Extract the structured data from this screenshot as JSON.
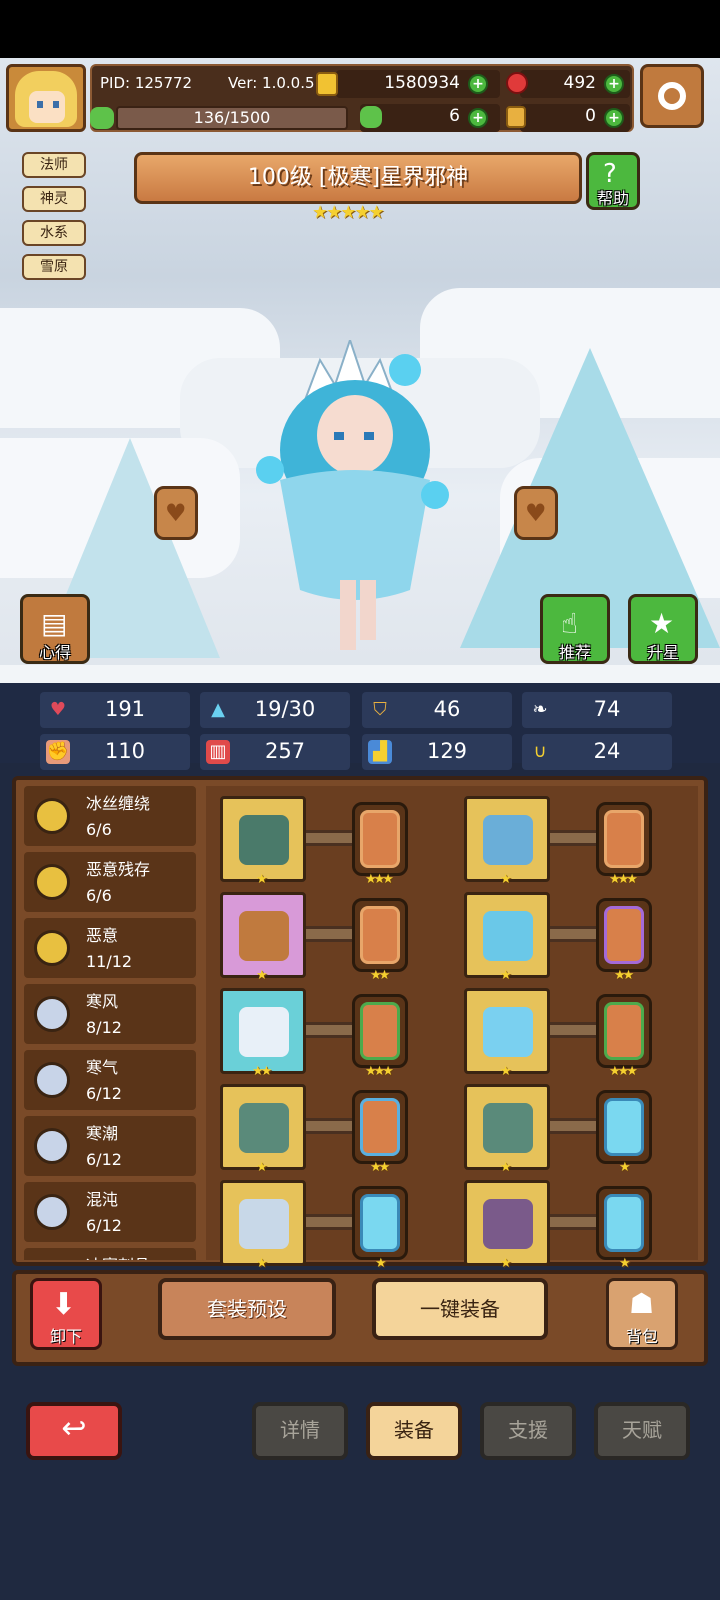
{
  "header": {
    "pid": "PID: 125772",
    "version": "Ver: 1.0.0.5",
    "gold": "1580934",
    "gems": "492",
    "exp": "136/1500",
    "clover": "6",
    "keys": "0"
  },
  "tags": [
    "法师",
    "神灵",
    "水系",
    "雪原"
  ],
  "hero": {
    "title": "100级  [极寒]星界邪神",
    "stars": "★★★★★",
    "help_label": "帮助",
    "notes_label": "心得",
    "recommend_label": "推荐",
    "upgrade_label": "升星"
  },
  "stats": [
    {
      "icon": "heart-icon",
      "value": "191"
    },
    {
      "icon": "water-drop-icon",
      "value": "19/30"
    },
    {
      "icon": "shield-icon",
      "value": "46"
    },
    {
      "icon": "wing-icon",
      "value": "74"
    },
    {
      "icon": "fist-icon",
      "value": "110"
    },
    {
      "icon": "book-icon",
      "value": "257"
    },
    {
      "icon": "boot-icon",
      "value": "129"
    },
    {
      "icon": "horseshoe-icon",
      "value": "24"
    }
  ],
  "sets": [
    {
      "name": "冰丝缠绕",
      "count": "6/6",
      "color": "#e8c040"
    },
    {
      "name": "恶意残存",
      "count": "6/6",
      "color": "#e8c040"
    },
    {
      "name": "恶意",
      "count": "11/12",
      "color": "#e8c040"
    },
    {
      "name": "寒风",
      "count": "8/12",
      "color": "#c8d4e8"
    },
    {
      "name": "寒气",
      "count": "6/12",
      "color": "#c8d4e8"
    },
    {
      "name": "寒潮",
      "count": "6/12",
      "color": "#c8d4e8"
    },
    {
      "name": "混沌",
      "count": "6/12",
      "color": "#c8d4e8"
    },
    {
      "name": "冰寒刺骨",
      "count": "",
      "color": "#9aa070"
    }
  ],
  "equipment": [
    {
      "slot_stars": "★",
      "card_stars": "★★★",
      "slot_style": "gold",
      "card_style": "gold"
    },
    {
      "slot_stars": "★",
      "card_stars": "★★★",
      "slot_style": "gold",
      "card_style": "gold"
    },
    {
      "slot_stars": "★",
      "card_stars": "★★",
      "slot_style": "pink",
      "card_style": "gold"
    },
    {
      "slot_stars": "★",
      "card_stars": "★★",
      "slot_style": "gold",
      "card_style": "purple"
    },
    {
      "slot_stars": "★★",
      "card_stars": "★★★",
      "slot_style": "cyan",
      "card_style": "green"
    },
    {
      "slot_stars": "★",
      "card_stars": "★★★",
      "slot_style": "gold",
      "card_style": "green"
    },
    {
      "slot_stars": "★",
      "card_stars": "★★",
      "slot_style": "gold",
      "card_style": "blue-frame"
    },
    {
      "slot_stars": "★",
      "card_stars": "★",
      "slot_style": "gold",
      "card_style": "blue"
    },
    {
      "slot_stars": "★",
      "card_stars": "★",
      "slot_style": "gold",
      "card_style": "blue"
    },
    {
      "slot_stars": "★",
      "card_stars": "★",
      "slot_style": "gold",
      "card_style": "blue"
    }
  ],
  "actions": {
    "unequip": "卸下",
    "preset": "套装预设",
    "one_click": "一键装备",
    "bag": "背包"
  },
  "tabs": [
    "详情",
    "装备",
    "支援",
    "天赋"
  ],
  "active_tab": "装备",
  "colors": {
    "panel": "#7a4a28",
    "accent_gold": "#f5d030",
    "back_red": "#e84a4a"
  }
}
